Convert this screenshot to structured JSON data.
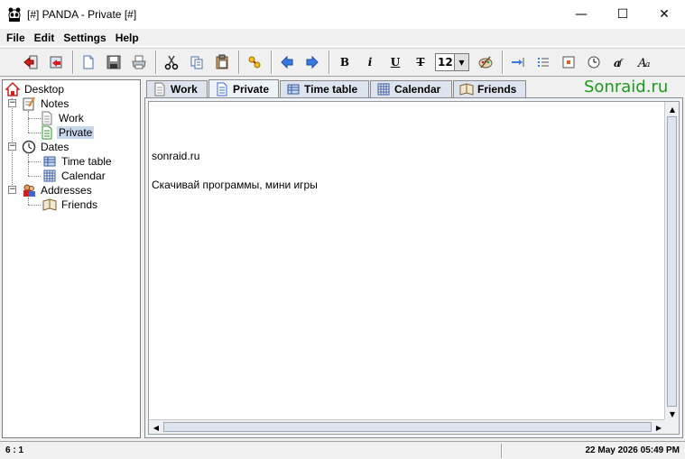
{
  "window": {
    "title": "[#] PANDA - Private [#]",
    "min_glyph": "—",
    "max_glyph": "☐",
    "close_glyph": "✕"
  },
  "menu": [
    {
      "label": "File",
      "key": "F"
    },
    {
      "label": "Edit",
      "key": "E"
    },
    {
      "label": "Settings",
      "key": "S"
    },
    {
      "label": "Help",
      "key": "H"
    }
  ],
  "toolbar": {
    "font_size": "12",
    "icons": [
      "exit-icon",
      "undo-icon",
      "new-document-icon",
      "save-icon",
      "print-icon",
      "cut-icon",
      "copy-icon",
      "paste-icon",
      "link-icon",
      "back-arrow-icon",
      "forward-arrow-icon",
      "bold-icon",
      "italic-icon",
      "underline-icon",
      "strikethrough-icon",
      "font-size-select",
      "color-palette-icon",
      "indent-icon",
      "list-icon",
      "insert-date-icon",
      "clock-icon",
      "font-icon",
      "font-style-icon"
    ],
    "bold_glyph": "B",
    "italic_glyph": "i",
    "underline_glyph": "U",
    "strike_glyph": "T"
  },
  "tree": {
    "desktop": "Desktop",
    "notes": "Notes",
    "work": "Work",
    "private": "Private",
    "dates": "Dates",
    "time_table": "Time table",
    "calendar": "Calendar",
    "addresses": "Addresses",
    "friends": "Friends"
  },
  "tabs": [
    {
      "label": "Work"
    },
    {
      "label": "Private"
    },
    {
      "label": "Time table"
    },
    {
      "label": "Calendar"
    },
    {
      "label": "Friends"
    }
  ],
  "brand": "Sonraid.ru",
  "editor": {
    "lines": [
      "",
      "sonraid.ru",
      "",
      "Скачивай программы, мини игры"
    ]
  },
  "status": {
    "position": "6 : 1",
    "datetime": "22 May 2026  05:49 PM"
  },
  "colors": {
    "brand": "#1a9c1a",
    "selection": "#c7d7ec",
    "tab_active": "#eef3fa"
  }
}
